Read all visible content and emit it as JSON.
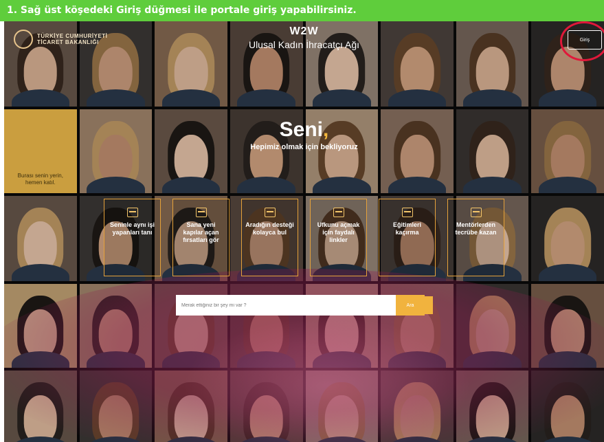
{
  "instruction": {
    "text": "1. Sağ üst köşedeki Giriş düğmesi ile portale giriş yapabilirsiniz."
  },
  "header": {
    "logo_text": "TÜRKİYE CUMHURİYETİ TİCARET BAKANLIĞI",
    "brand": "W2W",
    "subtitle": "Ulusal Kadın İhracatçı Ağı",
    "login_label": "Giriş"
  },
  "hero": {
    "headline": "Seni",
    "headline_accent": ",",
    "tagline": "Hepimiz olmak için bekliyoruz"
  },
  "yellow_tile": {
    "text": "Burası senin yerin, hemen katıl."
  },
  "features": [
    {
      "icon": "profile-card-icon",
      "label": "Seninle aynı işi yapanları tanı"
    },
    {
      "icon": "door-icon",
      "label": "Sana yeni kapılar açan fırsatları gör"
    },
    {
      "icon": "support-icon",
      "label": "Aradığın desteği kolayca bul"
    },
    {
      "icon": "link-icon",
      "label": "Ufkunu açmak için faydalı linkler"
    },
    {
      "icon": "training-icon",
      "label": "Eğitimleri kaçırma"
    },
    {
      "icon": "mentor-icon",
      "label": "Mentörlerden tecrübe kazan"
    }
  ],
  "search": {
    "placeholder": "Merak ettiğiniz bir şey mi var ?",
    "button_label": "Ara"
  },
  "colors": {
    "instruction_bar": "#5fcd3c",
    "accent": "#f1b33e",
    "highlight_ring": "#e0183a"
  }
}
